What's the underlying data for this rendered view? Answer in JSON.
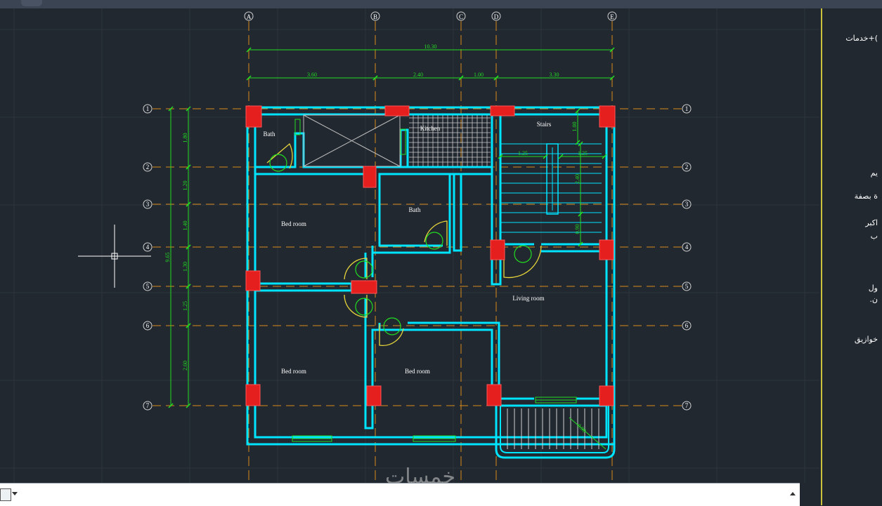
{
  "grid_columns": [
    "A",
    "B",
    "C",
    "D",
    "E"
  ],
  "grid_rows": [
    "1",
    "2",
    "3",
    "4",
    "5",
    "6",
    "7"
  ],
  "dims_top_total": "10.30",
  "dims_top": [
    "3.60",
    "2.40",
    "1.00",
    "3.30"
  ],
  "dims_left_total": "9.65",
  "dims_left": [
    "1.80",
    "1.20",
    "1.40",
    "1.30",
    "1.25",
    "2.60"
  ],
  "rooms": {
    "bath1": "Bath",
    "kitchen": "Kitchen",
    "stairs": "Stairs",
    "bedroom1": "Bed room",
    "bath2": "Bath",
    "living": "Living room",
    "bedroom2": "Bed room",
    "bedroom3": "Bed room"
  },
  "stair_dims": {
    "top": "1.00",
    "left": "1.25",
    "right": "1.25",
    "vertical": "2.40",
    "lower": "0.90"
  },
  "balcony_dim": "0.90",
  "side_panel": {
    "line1": ")+خدمات",
    "line2": "يم",
    "line3": "ة بصفة",
    "line4": "اكبر",
    "line5": "ب",
    "line6": "ول",
    "line7": "ن.",
    "line8": "خوازيق"
  },
  "command_line": {
    "value": ""
  },
  "watermark": "خمسات",
  "colors": {
    "background": "#212830",
    "wall": "#00e5ff",
    "column": "#e51e1e",
    "axis": "#d98a1a",
    "dimension": "#22dd22",
    "door": "#e6d43a",
    "panel_border": "#c9c23a"
  }
}
